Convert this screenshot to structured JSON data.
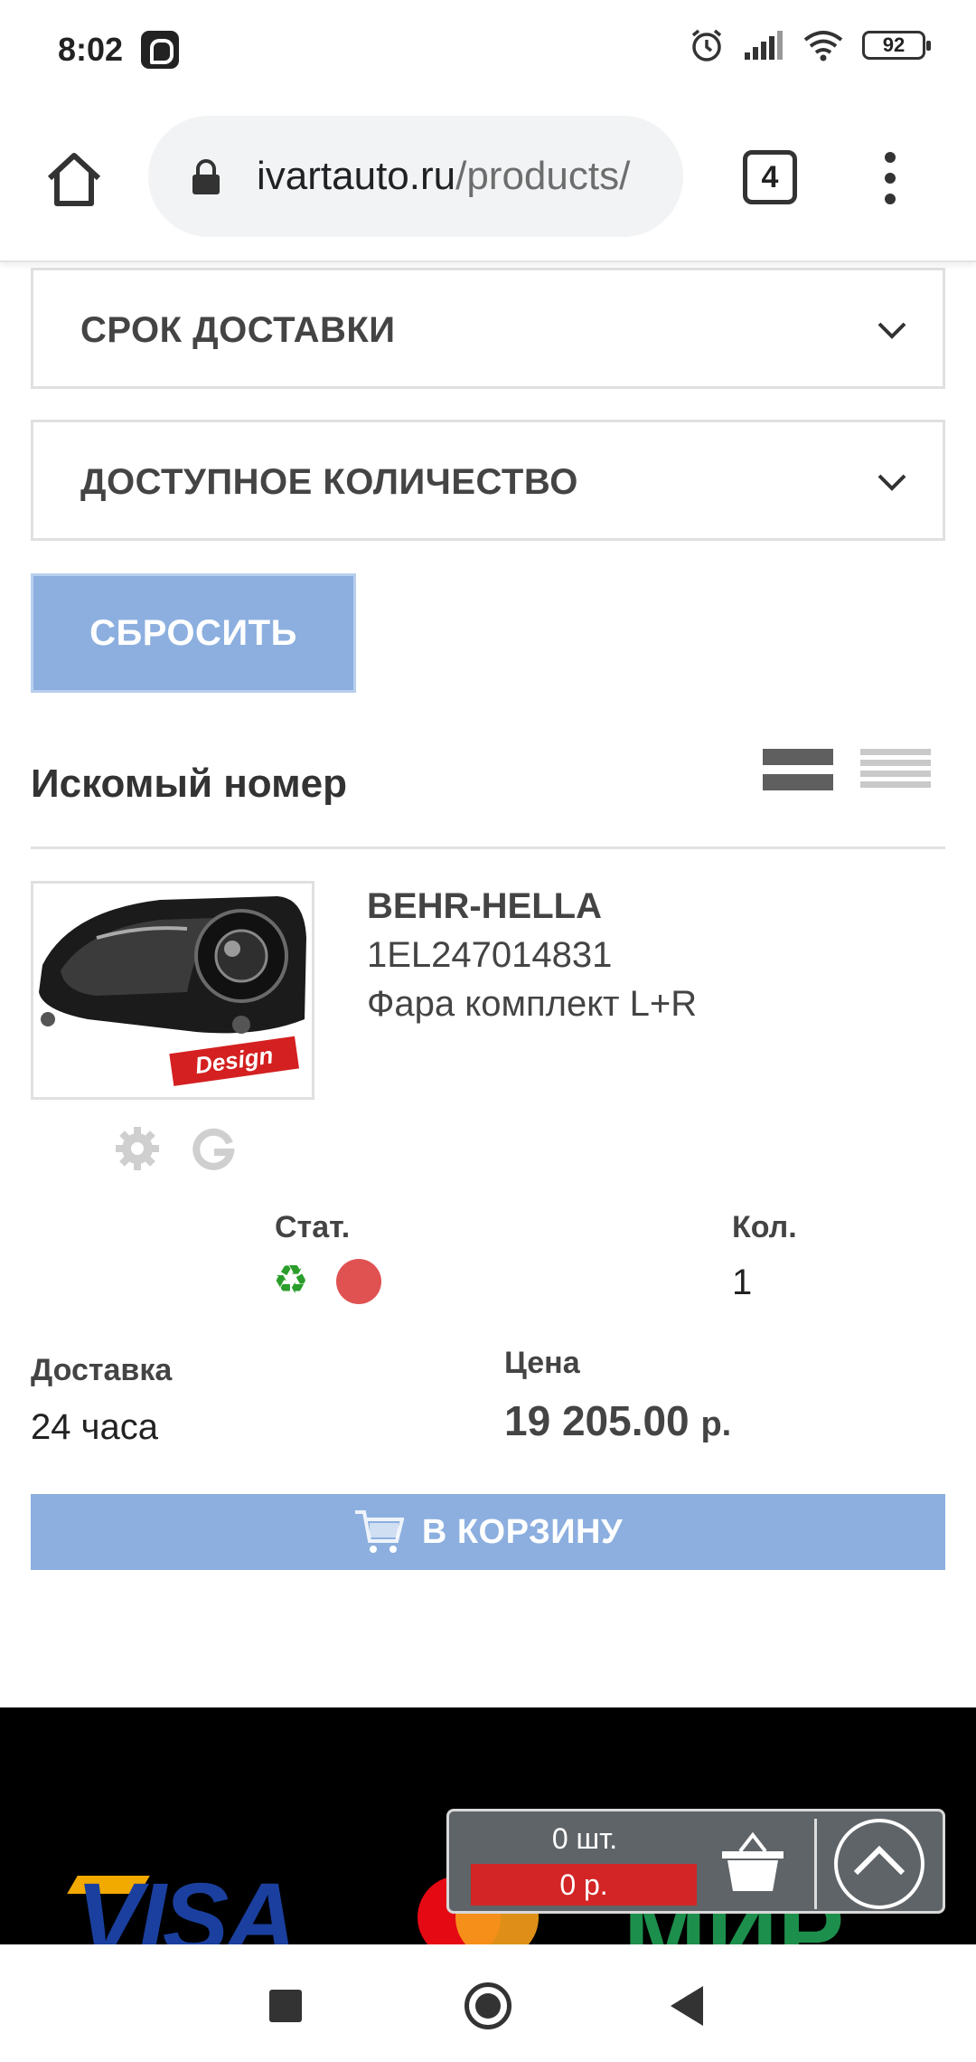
{
  "status_bar": {
    "time": "8:02",
    "battery": "92",
    "icons": [
      "alarm-icon",
      "signal-icon",
      "wifi-icon",
      "battery-icon"
    ]
  },
  "browser": {
    "url_domain": "ivartauto.ru",
    "url_path": "/products/",
    "tab_count": "4"
  },
  "filters": [
    {
      "label": "СРОК ДОСТАВКИ"
    },
    {
      "label": "ДОСТУПНОЕ КОЛИЧЕСТВО"
    }
  ],
  "reset_label": "СБРОСИТЬ",
  "section_title": "Искомый номер",
  "product": {
    "brand": "BEHR-HELLA",
    "part_number": "1EL247014831",
    "description": "Фара комплект L+R",
    "image_badge": "Design",
    "status_label": "Стат.",
    "qty_label": "Кол.",
    "qty_value": "1",
    "delivery_label": "Доставка",
    "delivery_value": "24 часа",
    "price_label": "Цена",
    "price_value": "19 205.00",
    "price_currency": "р."
  },
  "cart_button_label": "В КОРЗИНУ",
  "mini_cart": {
    "count": "0 шт.",
    "sum": "0 р."
  },
  "footer_logos": {
    "visa": "VISA",
    "mir": "МИР"
  },
  "colors": {
    "accent_button": "#8cafdf",
    "status_dot": "#e05252",
    "recycle": "#2a9d2a",
    "mini_cart_sum": "#d32525"
  }
}
